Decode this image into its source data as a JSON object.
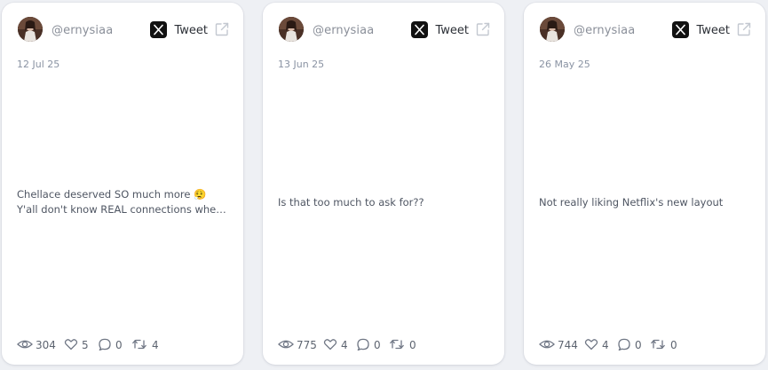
{
  "cards": [
    {
      "username": "@ernysiaa",
      "tweet_label": "Tweet",
      "date": "12 Jul 25",
      "text_lines": [
        "Chellace deserved SO much more 😮‍💨",
        "Y'all don't know REAL connections when..."
      ],
      "views": "304",
      "likes": "5",
      "replies": "0",
      "retweets": "4"
    },
    {
      "username": "@ernysiaa",
      "tweet_label": "Tweet",
      "date": "13 Jun 25",
      "text_lines": [
        "Is that too much to ask for??"
      ],
      "views": "775",
      "likes": "4",
      "replies": "0",
      "retweets": "0"
    },
    {
      "username": "@ernysiaa",
      "tweet_label": "Tweet",
      "date": "26 May 25",
      "text_lines": [
        "Not really liking Netflix's new layout"
      ],
      "views": "744",
      "likes": "4",
      "replies": "0",
      "retweets": "0"
    }
  ],
  "icons": {
    "brand": "x-logo-icon",
    "open": "external-link-icon",
    "views": "eye-icon",
    "likes": "heart-icon",
    "replies": "comment-icon",
    "retweets": "retweet-icon"
  },
  "colors": {
    "page_background": "#eef0f4",
    "card_background": "#ffffff",
    "muted_text": "#8a8f99",
    "body_text": "#4f5663",
    "icon_stroke": "#707785"
  }
}
